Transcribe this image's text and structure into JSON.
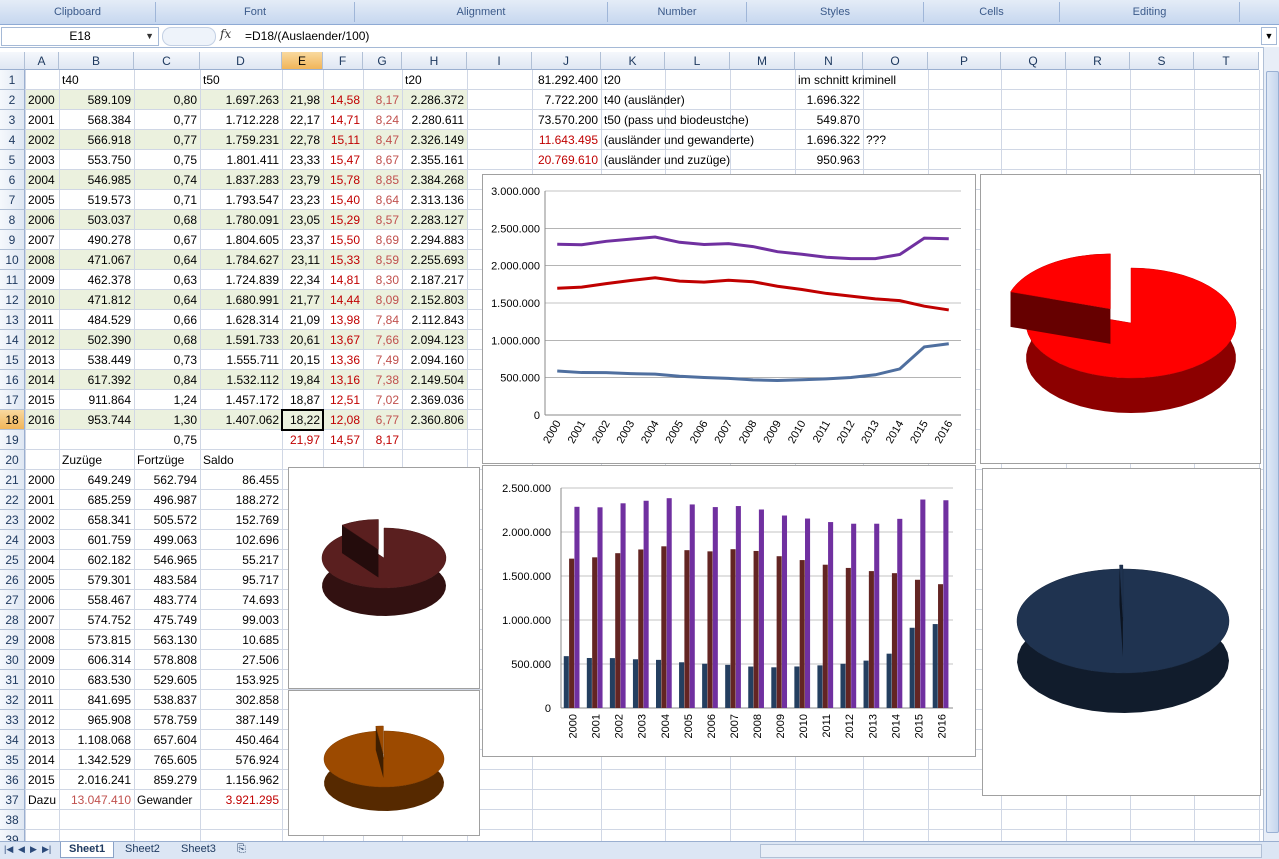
{
  "ribbon": {
    "groups": [
      {
        "name": "Clipboard",
        "left": 0,
        "width": 156
      },
      {
        "name": "Font",
        "left": 156,
        "width": 199
      },
      {
        "name": "Alignment",
        "left": 355,
        "width": 253
      },
      {
        "name": "Number",
        "left": 608,
        "width": 139
      },
      {
        "name": "Styles",
        "left": 747,
        "width": 177
      },
      {
        "name": "Cells",
        "left": 924,
        "width": 136
      },
      {
        "name": "Editing",
        "left": 1060,
        "width": 180
      }
    ]
  },
  "formula_bar": {
    "name_box": "E18",
    "fx": "fx",
    "formula": "=D18/(Auslaender/100)"
  },
  "columns": [
    "A",
    "B",
    "C",
    "D",
    "E",
    "F",
    "G",
    "H",
    "I",
    "J",
    "K",
    "L",
    "M",
    "N",
    "O",
    "P",
    "Q",
    "R",
    "S",
    "T"
  ],
  "rows": [
    "1",
    "2",
    "3",
    "4",
    "5",
    "6",
    "7",
    "8",
    "9",
    "10",
    "11",
    "12",
    "13",
    "14",
    "15",
    "16",
    "17",
    "18",
    "19",
    "20",
    "21",
    "22",
    "23",
    "24",
    "25",
    "26",
    "27",
    "28",
    "29",
    "30",
    "31",
    "32",
    "33",
    "34",
    "35",
    "36",
    "37",
    "38",
    "39"
  ],
  "active_cell": {
    "col": "E",
    "row": "18"
  },
  "table1": {
    "headers": {
      "b": "t40",
      "d": "t50",
      "h": "t20"
    },
    "rows": [
      [
        "2000",
        "589.109",
        "0,80",
        "1.697.263",
        "21,98",
        "14,58",
        "8,17",
        "2.286.372"
      ],
      [
        "2001",
        "568.384",
        "0,77",
        "1.712.228",
        "22,17",
        "14,71",
        "8,24",
        "2.280.611"
      ],
      [
        "2002",
        "566.918",
        "0,77",
        "1.759.231",
        "22,78",
        "15,11",
        "8,47",
        "2.326.149"
      ],
      [
        "2003",
        "553.750",
        "0,75",
        "1.801.411",
        "23,33",
        "15,47",
        "8,67",
        "2.355.161"
      ],
      [
        "2004",
        "546.985",
        "0,74",
        "1.837.283",
        "23,79",
        "15,78",
        "8,85",
        "2.384.268"
      ],
      [
        "2005",
        "519.573",
        "0,71",
        "1.793.547",
        "23,23",
        "15,40",
        "8,64",
        "2.313.136"
      ],
      [
        "2006",
        "503.037",
        "0,68",
        "1.780.091",
        "23,05",
        "15,29",
        "8,57",
        "2.283.127"
      ],
      [
        "2007",
        "490.278",
        "0,67",
        "1.804.605",
        "23,37",
        "15,50",
        "8,69",
        "2.294.883"
      ],
      [
        "2008",
        "471.067",
        "0,64",
        "1.784.627",
        "23,11",
        "15,33",
        "8,59",
        "2.255.693"
      ],
      [
        "2009",
        "462.378",
        "0,63",
        "1.724.839",
        "22,34",
        "14,81",
        "8,30",
        "2.187.217"
      ],
      [
        "2010",
        "471.812",
        "0,64",
        "1.680.991",
        "21,77",
        "14,44",
        "8,09",
        "2.152.803"
      ],
      [
        "2011",
        "484.529",
        "0,66",
        "1.628.314",
        "21,09",
        "13,98",
        "7,84",
        "2.112.843"
      ],
      [
        "2012",
        "502.390",
        "0,68",
        "1.591.733",
        "20,61",
        "13,67",
        "7,66",
        "2.094.123"
      ],
      [
        "2013",
        "538.449",
        "0,73",
        "1.555.711",
        "20,15",
        "13,36",
        "7,49",
        "2.094.160"
      ],
      [
        "2014",
        "617.392",
        "0,84",
        "1.532.112",
        "19,84",
        "13,16",
        "7,38",
        "2.149.504"
      ],
      [
        "2015",
        "911.864",
        "1,24",
        "1.457.172",
        "18,87",
        "12,51",
        "7,02",
        "2.369.036"
      ],
      [
        "2016",
        "953.744",
        "1,30",
        "1.407.062",
        "18,22",
        "12,08",
        "6,77",
        "2.360.806"
      ]
    ],
    "row19": {
      "c": "0,75",
      "e": "21,97",
      "f": "14,57",
      "g": "8,17"
    }
  },
  "info": [
    {
      "j": "81.292.400",
      "k": "t20",
      "n": "im schnitt kriminell",
      "o": "",
      "jred": false
    },
    {
      "j": "7.722.200",
      "k": "t40 (ausländer)",
      "n": "1.696.322",
      "o": "",
      "jred": false
    },
    {
      "j": "73.570.200",
      "k": "t50 (pass und biodeustche)",
      "n": "549.870",
      "o": "",
      "jred": false
    },
    {
      "j": "11.643.495",
      "k": "(ausländer und gewanderte)",
      "n": "1.696.322",
      "o": "???",
      "jred": true
    },
    {
      "j": "20.769.610",
      "k": "(ausländer und zuzüge)",
      "n": "950.963",
      "o": "",
      "jred": true
    }
  ],
  "table2": {
    "headers": {
      "b": "Zuzüge",
      "c": "Fortzüge",
      "d": "Saldo"
    },
    "rows": [
      [
        "2000",
        "649.249",
        "562.794",
        "86.455"
      ],
      [
        "2001",
        "685.259",
        "496.987",
        "188.272"
      ],
      [
        "2002",
        "658.341",
        "505.572",
        "152.769"
      ],
      [
        "2003",
        "601.759",
        "499.063",
        "102.696"
      ],
      [
        "2004",
        "602.182",
        "546.965",
        "55.217"
      ],
      [
        "2005",
        "579.301",
        "483.584",
        "95.717"
      ],
      [
        "2006",
        "558.467",
        "483.774",
        "74.693"
      ],
      [
        "2007",
        "574.752",
        "475.749",
        "99.003"
      ],
      [
        "2008",
        "573.815",
        "563.130",
        "10.685"
      ],
      [
        "2009",
        "606.314",
        "578.808",
        "27.506"
      ],
      [
        "2010",
        "683.530",
        "529.605",
        "153.925"
      ],
      [
        "2011",
        "841.695",
        "538.837",
        "302.858"
      ],
      [
        "2012",
        "965.908",
        "578.759",
        "387.149"
      ],
      [
        "2013",
        "1.108.068",
        "657.604",
        "450.464"
      ],
      [
        "2014",
        "1.342.529",
        "765.605",
        "576.924"
      ],
      [
        "2015",
        "2.016.241",
        "859.279",
        "1.156.962"
      ]
    ],
    "row37": {
      "a": "Dazu",
      "b": "13.047.410",
      "c": "Gewander",
      "d": "3.921.295"
    }
  },
  "chart_data": [
    {
      "type": "line",
      "x": [
        "2000",
        "2001",
        "2002",
        "2003",
        "2004",
        "2005",
        "2006",
        "2007",
        "2008",
        "2009",
        "2010",
        "2011",
        "2012",
        "2013",
        "2014",
        "2015",
        "2016"
      ],
      "ylim": [
        0,
        3000000
      ],
      "yticks": [
        "0",
        "500.000",
        "1.000.000",
        "1.500.000",
        "2.000.000",
        "2.500.000",
        "3.000.000"
      ],
      "series": [
        {
          "color": "#4f6f9f",
          "values": [
            589109,
            568384,
            566918,
            553750,
            546985,
            519573,
            503037,
            490278,
            471067,
            462378,
            471812,
            484529,
            502390,
            538449,
            617392,
            911864,
            953744
          ]
        },
        {
          "color": "#c00000",
          "values": [
            1697263,
            1712228,
            1759231,
            1801411,
            1837283,
            1793547,
            1780091,
            1804605,
            1784627,
            1724839,
            1680991,
            1628314,
            1591733,
            1555711,
            1532112,
            1457172,
            1407062
          ]
        },
        {
          "color": "#7030a0",
          "values": [
            2286372,
            2280611,
            2326149,
            2355161,
            2384268,
            2313136,
            2283127,
            2294883,
            2255693,
            2187217,
            2152803,
            2112843,
            2094123,
            2094160,
            2149504,
            2369036,
            2360806
          ]
        }
      ],
      "grid": true
    },
    {
      "type": "bar",
      "categories": [
        "2000",
        "2001",
        "2002",
        "2003",
        "2004",
        "2005",
        "2006",
        "2007",
        "2008",
        "2009",
        "2010",
        "2011",
        "2012",
        "2013",
        "2014",
        "2015",
        "2016"
      ],
      "ylim": [
        0,
        2500000
      ],
      "yticks": [
        "0",
        "500.000",
        "1.000.000",
        "1.500.000",
        "2.000.000",
        "2.500.000"
      ],
      "series": [
        {
          "color": "#243f60",
          "values": [
            589109,
            568384,
            566918,
            553750,
            546985,
            519573,
            503037,
            490278,
            471067,
            462378,
            471812,
            484529,
            502390,
            538449,
            617392,
            911864,
            953744
          ]
        },
        {
          "color": "#632523",
          "values": [
            1697263,
            1712228,
            1759231,
            1801411,
            1837283,
            1793547,
            1780091,
            1804605,
            1784627,
            1724839,
            1680991,
            1628314,
            1591733,
            1555711,
            1532112,
            1457172,
            1407062
          ]
        },
        {
          "color": "#7030a0",
          "values": [
            2286372,
            2280611,
            2326149,
            2355161,
            2384268,
            2313136,
            2283127,
            2294883,
            2255693,
            2187217,
            2152803,
            2112843,
            2094123,
            2094160,
            2149504,
            2369036,
            2360806
          ]
        }
      ],
      "grid": true
    },
    {
      "type": "pie",
      "color": "#ff0000",
      "values": [
        0.8,
        0.2
      ]
    },
    {
      "type": "pie",
      "color": "#5a1f1f",
      "values": [
        0.9,
        0.1
      ]
    },
    {
      "type": "pie",
      "color": "#9c4a00",
      "values": [
        0.98,
        0.02
      ]
    },
    {
      "type": "pie",
      "color": "#1f3350",
      "values": [
        0.995,
        0.005
      ]
    }
  ],
  "sheets": {
    "tabs": [
      "Sheet1",
      "Sheet2",
      "Sheet3"
    ],
    "active": "Sheet1"
  }
}
